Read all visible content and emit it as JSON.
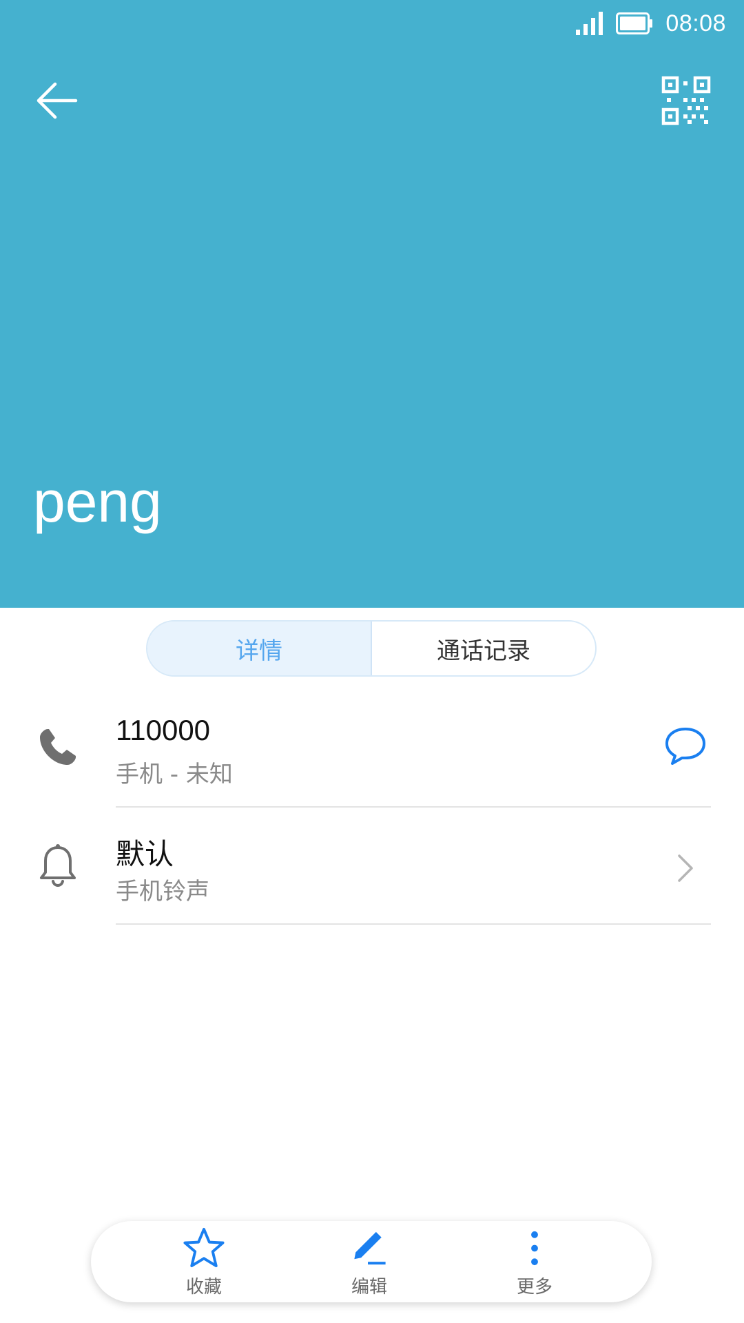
{
  "status_bar": {
    "time": "08:08",
    "signal_icon": "signal-icon",
    "battery_icon": "battery-icon"
  },
  "header": {
    "back_icon": "arrow-left-icon",
    "qr_icon": "qr-code-icon",
    "contact_name": "peng",
    "background_color": "#45b1cf"
  },
  "tabs": [
    {
      "label": "详情",
      "active": true
    },
    {
      "label": "通话记录",
      "active": false
    }
  ],
  "details": {
    "phone": {
      "number": "110000",
      "type": "手机 - 未知",
      "icon": "phone-icon",
      "action_icon": "message-icon"
    },
    "ringtone": {
      "value": "默认",
      "label": "手机铃声",
      "icon": "bell-icon",
      "action_icon": "chevron-right-icon"
    }
  },
  "bottom_bar": {
    "favorite": {
      "label": "收藏",
      "icon": "star-icon"
    },
    "edit": {
      "label": "编辑",
      "icon": "pencil-icon"
    },
    "more": {
      "label": "更多",
      "icon": "more-vertical-icon"
    }
  },
  "colors": {
    "accent": "#1a7ff0",
    "tab_active_text": "#55a6ee"
  }
}
